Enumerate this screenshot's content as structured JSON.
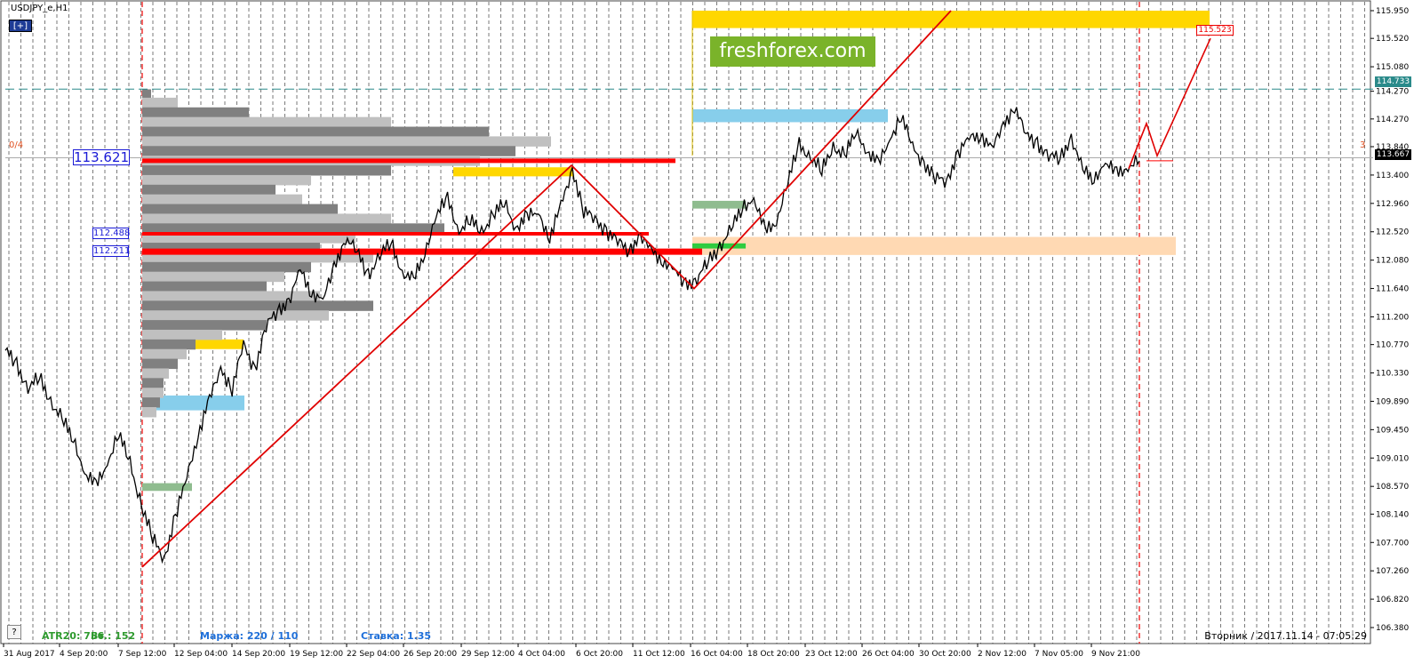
{
  "window": {
    "symbol": "USDJPY_e,H1",
    "plus_label": "[+]",
    "help_label": "?"
  },
  "watermark": "freshforex.com",
  "indicators": {
    "atr": "ATR20: 756",
    "vt": "Вт.: 152",
    "margin": "Маржа: 220 / 110",
    "rate": "Ставка: 1.35"
  },
  "timestamp": "Вторник  /  2017.11.14  -  07:05:29",
  "labels": {
    "fib_left": "0/4",
    "fib_right": "3",
    "price_main": "113.621",
    "price_2": "112.488",
    "price_3": "112.211",
    "target": "115.523"
  },
  "axis_badges": {
    "level": "114.733",
    "price": "113.667"
  },
  "colors": {
    "bull_candle": "#000000",
    "zigzag": "#e00000",
    "level_line": "#2a8a8a",
    "watermark_bg": "#7ab32a",
    "gold_zone": "#ffd700",
    "blue_zone": "#87ceeb",
    "green_zone": "#8fbc8f",
    "orange_zone": "#ffd9b3",
    "profile_dark": "#808080",
    "profile_light": "#c0c0c0"
  },
  "chart_data": {
    "type": "line",
    "series": [
      {
        "values": []
      }
    ],
    "x_ticks": [
      "31 Aug 2017",
      "4 Sep 20:00",
      "7 Sep 12:00",
      "12 Sep 04:00",
      "14 Sep 20:00",
      "19 Sep 12:00",
      "22 Sep 04:00",
      "26 Sep 20:00",
      "29 Sep 12:00",
      "4 Oct 04:00",
      "6 Oct 20:00",
      "11 Oct 12:00",
      "16 Oct 04:00",
      "18 Oct 20:00",
      "23 Oct 12:00",
      "26 Oct 04:00",
      "30 Oct 20:00",
      "2 Nov 12:00",
      "7 Nov 05:00",
      "9 Nov 21:00"
    ],
    "y_ticks": [
      "115.950",
      "115.520",
      "115.080",
      "114.270",
      "114.270",
      "113.840",
      "113.400",
      "112.960",
      "112.520",
      "112.080",
      "111.640",
      "111.200",
      "110.770",
      "110.330",
      "109.890",
      "109.450",
      "109.010",
      "108.570",
      "108.140",
      "107.700",
      "107.260",
      "106.820",
      "106.380"
    ],
    "y_tick_values": [
      115.95,
      115.52,
      115.08,
      114.7,
      114.27,
      113.84,
      113.4,
      112.96,
      112.52,
      112.08,
      111.64,
      111.2,
      110.77,
      110.33,
      109.89,
      109.45,
      109.01,
      108.57,
      108.14,
      107.7,
      107.26,
      106.82,
      106.38
    ],
    "ylim": [
      106.38,
      115.95
    ],
    "price_path": [
      [
        0,
        110.68
      ],
      [
        3,
        110.45
      ],
      [
        6,
        110.1
      ],
      [
        9,
        110.25
      ],
      [
        12,
        109.9
      ],
      [
        15,
        109.6
      ],
      [
        18,
        109.3
      ],
      [
        21,
        108.8
      ],
      [
        24,
        108.55
      ],
      [
        27,
        108.95
      ],
      [
        30,
        109.4
      ],
      [
        33,
        108.9
      ],
      [
        36,
        108.3
      ],
      [
        39,
        107.75
      ],
      [
        42,
        107.45
      ],
      [
        45,
        108.1
      ],
      [
        48,
        108.7
      ],
      [
        51,
        109.4
      ],
      [
        54,
        109.9
      ],
      [
        57,
        110.4
      ],
      [
        60,
        110.1
      ],
      [
        63,
        110.75
      ],
      [
        66,
        110.4
      ],
      [
        69,
        111.05
      ],
      [
        72,
        111.3
      ],
      [
        75,
        111.45
      ],
      [
        78,
        111.9
      ],
      [
        81,
        111.6
      ],
      [
        84,
        111.45
      ],
      [
        87,
        111.95
      ],
      [
        90,
        112.45
      ],
      [
        93,
        112.2
      ],
      [
        96,
        111.85
      ],
      [
        99,
        112.15
      ],
      [
        102,
        112.35
      ],
      [
        105,
        111.9
      ],
      [
        108,
        111.75
      ],
      [
        111,
        112.2
      ],
      [
        114,
        112.8
      ],
      [
        117,
        113.0
      ],
      [
        120,
        112.55
      ],
      [
        123,
        112.7
      ],
      [
        126,
        112.5
      ],
      [
        129,
        112.8
      ],
      [
        132,
        112.95
      ],
      [
        135,
        112.6
      ],
      [
        138,
        112.75
      ],
      [
        141,
        112.8
      ],
      [
        144,
        112.45
      ],
      [
        147,
        112.9
      ],
      [
        150,
        113.5
      ],
      [
        153,
        112.85
      ],
      [
        156,
        112.7
      ],
      [
        159,
        112.55
      ],
      [
        162,
        112.35
      ],
      [
        165,
        112.25
      ],
      [
        168,
        112.45
      ],
      [
        171,
        112.2
      ],
      [
        174,
        112.1
      ],
      [
        177,
        111.9
      ],
      [
        180,
        111.7
      ],
      [
        183,
        111.8
      ],
      [
        186,
        112.05
      ],
      [
        189,
        112.3
      ],
      [
        192,
        112.55
      ],
      [
        195,
        112.9
      ],
      [
        198,
        113.05
      ],
      [
        201,
        112.5
      ],
      [
        204,
        112.7
      ],
      [
        207,
        113.3
      ],
      [
        210,
        113.85
      ],
      [
        213,
        113.7
      ],
      [
        216,
        113.45
      ],
      [
        219,
        113.85
      ],
      [
        222,
        113.7
      ],
      [
        225,
        114.05
      ],
      [
        228,
        113.8
      ],
      [
        231,
        113.55
      ],
      [
        234,
        113.95
      ],
      [
        237,
        114.35
      ],
      [
        240,
        113.8
      ],
      [
        243,
        113.6
      ],
      [
        246,
        113.35
      ],
      [
        249,
        113.3
      ],
      [
        252,
        113.75
      ],
      [
        255,
        113.95
      ],
      [
        258,
        114.05
      ],
      [
        261,
        113.8
      ],
      [
        264,
        114.15
      ],
      [
        267,
        114.5
      ],
      [
        270,
        114.0
      ],
      [
        273,
        113.9
      ],
      [
        276,
        113.7
      ],
      [
        279,
        113.65
      ],
      [
        282,
        114.0
      ],
      [
        285,
        113.45
      ],
      [
        288,
        113.35
      ],
      [
        291,
        113.6
      ],
      [
        294,
        113.4
      ],
      [
        297,
        113.55
      ],
      [
        300,
        113.62
      ]
    ],
    "volume_profile": [
      [
        114.73,
        5
      ],
      [
        114.6,
        20
      ],
      [
        114.45,
        60
      ],
      [
        114.3,
        140
      ],
      [
        114.15,
        195
      ],
      [
        114.0,
        230
      ],
      [
        113.85,
        210
      ],
      [
        113.7,
        190
      ],
      [
        113.55,
        140
      ],
      [
        113.4,
        95
      ],
      [
        113.25,
        75
      ],
      [
        113.1,
        90
      ],
      [
        112.95,
        110
      ],
      [
        112.8,
        140
      ],
      [
        112.65,
        170
      ],
      [
        112.5,
        120
      ],
      [
        112.35,
        100
      ],
      [
        112.2,
        130
      ],
      [
        112.05,
        95
      ],
      [
        111.9,
        80
      ],
      [
        111.75,
        70
      ],
      [
        111.6,
        100
      ],
      [
        111.45,
        130
      ],
      [
        111.3,
        105
      ],
      [
        111.15,
        70
      ],
      [
        111.0,
        45
      ],
      [
        110.85,
        30
      ],
      [
        110.7,
        25
      ],
      [
        110.55,
        20
      ],
      [
        110.4,
        15
      ],
      [
        110.25,
        12
      ],
      [
        110.1,
        12
      ],
      [
        109.95,
        10
      ],
      [
        109.8,
        8
      ]
    ]
  }
}
